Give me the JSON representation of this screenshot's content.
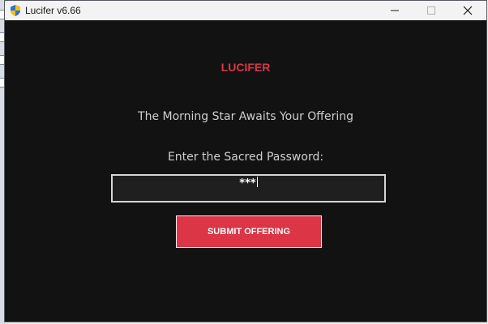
{
  "window": {
    "title": "Lucifer v6.66",
    "controls": {
      "minimize_icon": "minimize-icon",
      "maximize_icon": "maximize-icon",
      "close_icon": "close-icon"
    }
  },
  "main": {
    "logo_text": "LUCIFER",
    "subtitle": "The Morning Star Awaits Your Offering",
    "password_label": "Enter the Sacred Password:",
    "password_value": "***",
    "submit_label": "SUBMIT OFFERING"
  },
  "colors": {
    "accent": "#dc3545",
    "background": "#121212",
    "field_background": "#1f1f1f",
    "text": "#cfcfcf"
  }
}
